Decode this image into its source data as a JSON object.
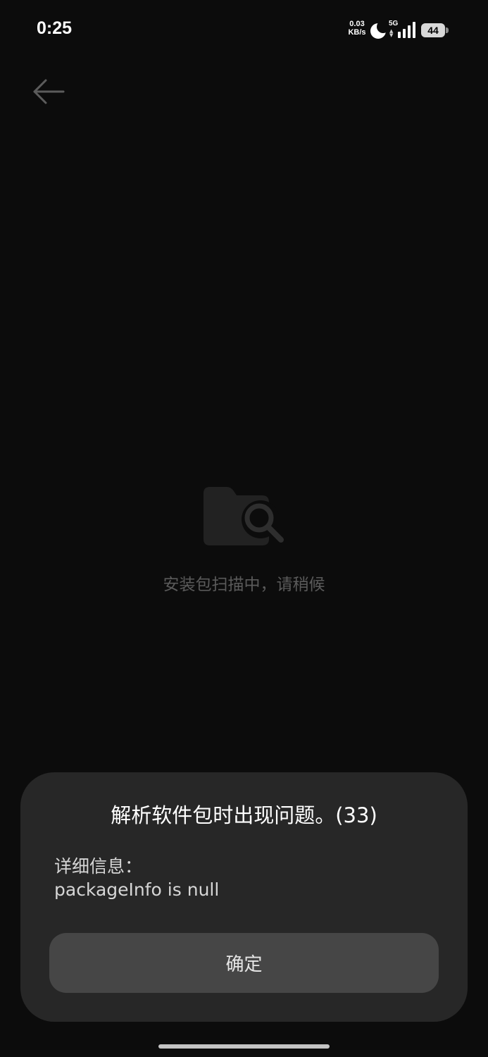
{
  "status_bar": {
    "time": "0:25",
    "net_speed_value": "0.03",
    "net_speed_unit": "KB/s",
    "network_type": "5G",
    "battery_level": "44",
    "icons": [
      "moon-icon",
      "signal-icon",
      "battery-icon"
    ]
  },
  "header": {
    "back_icon": "arrow-left-icon"
  },
  "main": {
    "illustration_icon": "folder-search-icon",
    "scan_status": "安装包扫描中，请稍候"
  },
  "dialog": {
    "title": "解析软件包时出现问题。(33)",
    "detail_label": "详细信息：",
    "detail_value": "packageInfo is null",
    "confirm_label": "确定"
  },
  "colors": {
    "background": "#0c0c0c",
    "dialog_background": "#272727",
    "button_background": "#464646",
    "muted_text": "#5a5a5a"
  }
}
